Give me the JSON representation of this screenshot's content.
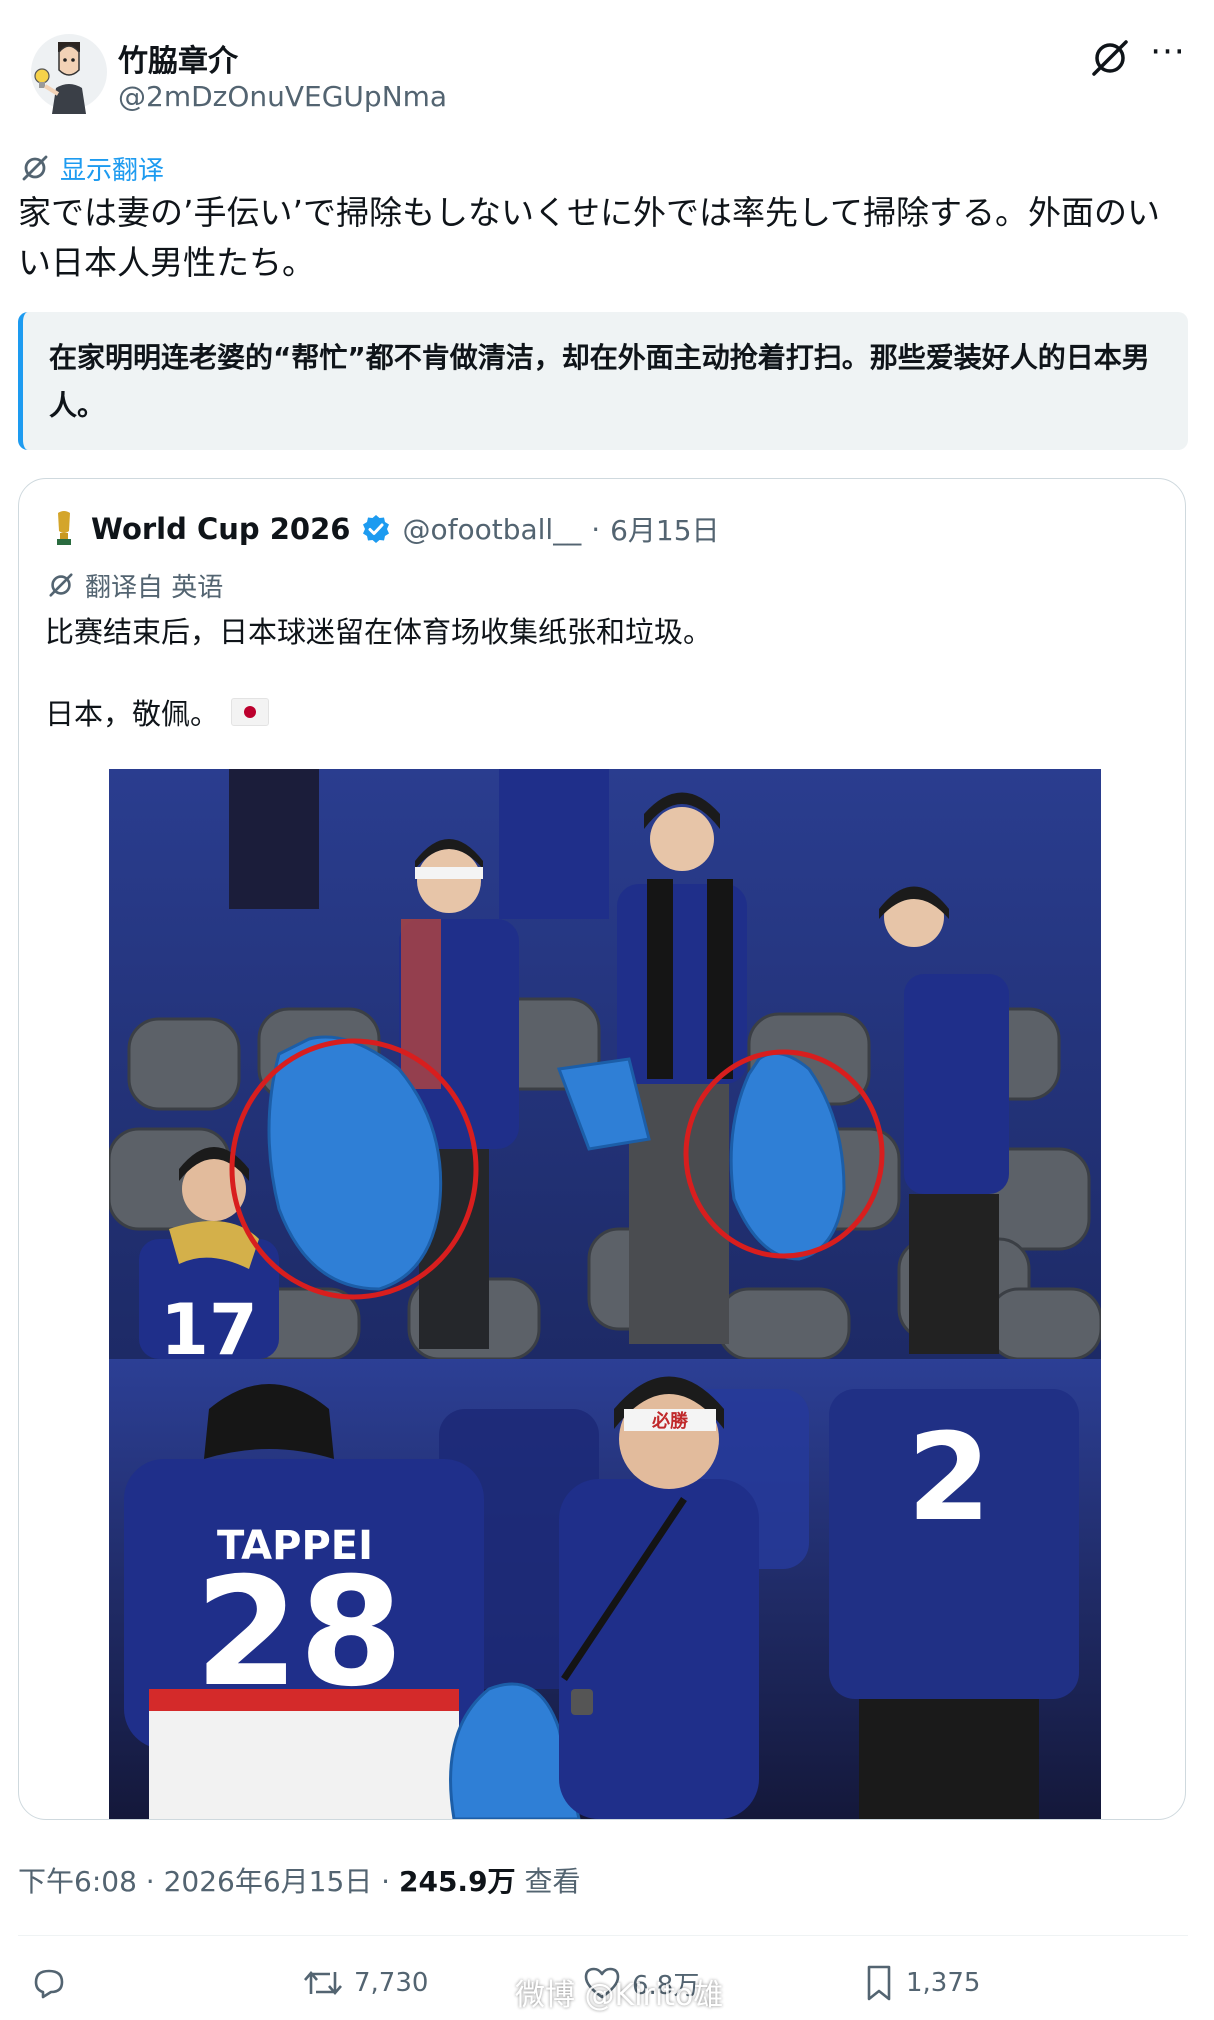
{
  "author": {
    "name": "竹脇章介",
    "handle": "@2mDzOnuVEGUpNma"
  },
  "translate": {
    "label": "显示翻译"
  },
  "tweet": {
    "text": "家では妻の’手伝い’で掃除もしないくせに外では率先して掃除する。外面のいい日本人男性たち。",
    "translation": "在家明明连老婆的“帮忙”都不肯做清洁，却在外面主动抢着打扫。那些爱装好人的日本男人。"
  },
  "quote": {
    "name": "World Cup 2026",
    "handle": "@ofootball__",
    "date": "6月15日",
    "translated_from": "翻译自 英语",
    "line1": "比赛结束后，日本球迷留在体育场收集纸张和垃圾。",
    "line2": "日本，敬佩。",
    "jersey_top": "17",
    "jersey_name": "TAPPEI",
    "jersey_num": "28",
    "jersey_right": "2",
    "headband_text": "必勝"
  },
  "meta": {
    "time_date": "下午6:08 · 2026年6月15日 · ",
    "views": "245.9万",
    "views_label": " 查看"
  },
  "actions": {
    "retweets": "7,730",
    "likes": "6.8万",
    "bookmarks": "1,375"
  },
  "watermark": "微博 @Kirito雄",
  "colors": {
    "accent": "#1d9bf0",
    "text": "#0f1419",
    "muted": "#536471",
    "circle": "#d81e1e",
    "jersey": "#1f2f8a",
    "bag": "#2f7fd6"
  }
}
